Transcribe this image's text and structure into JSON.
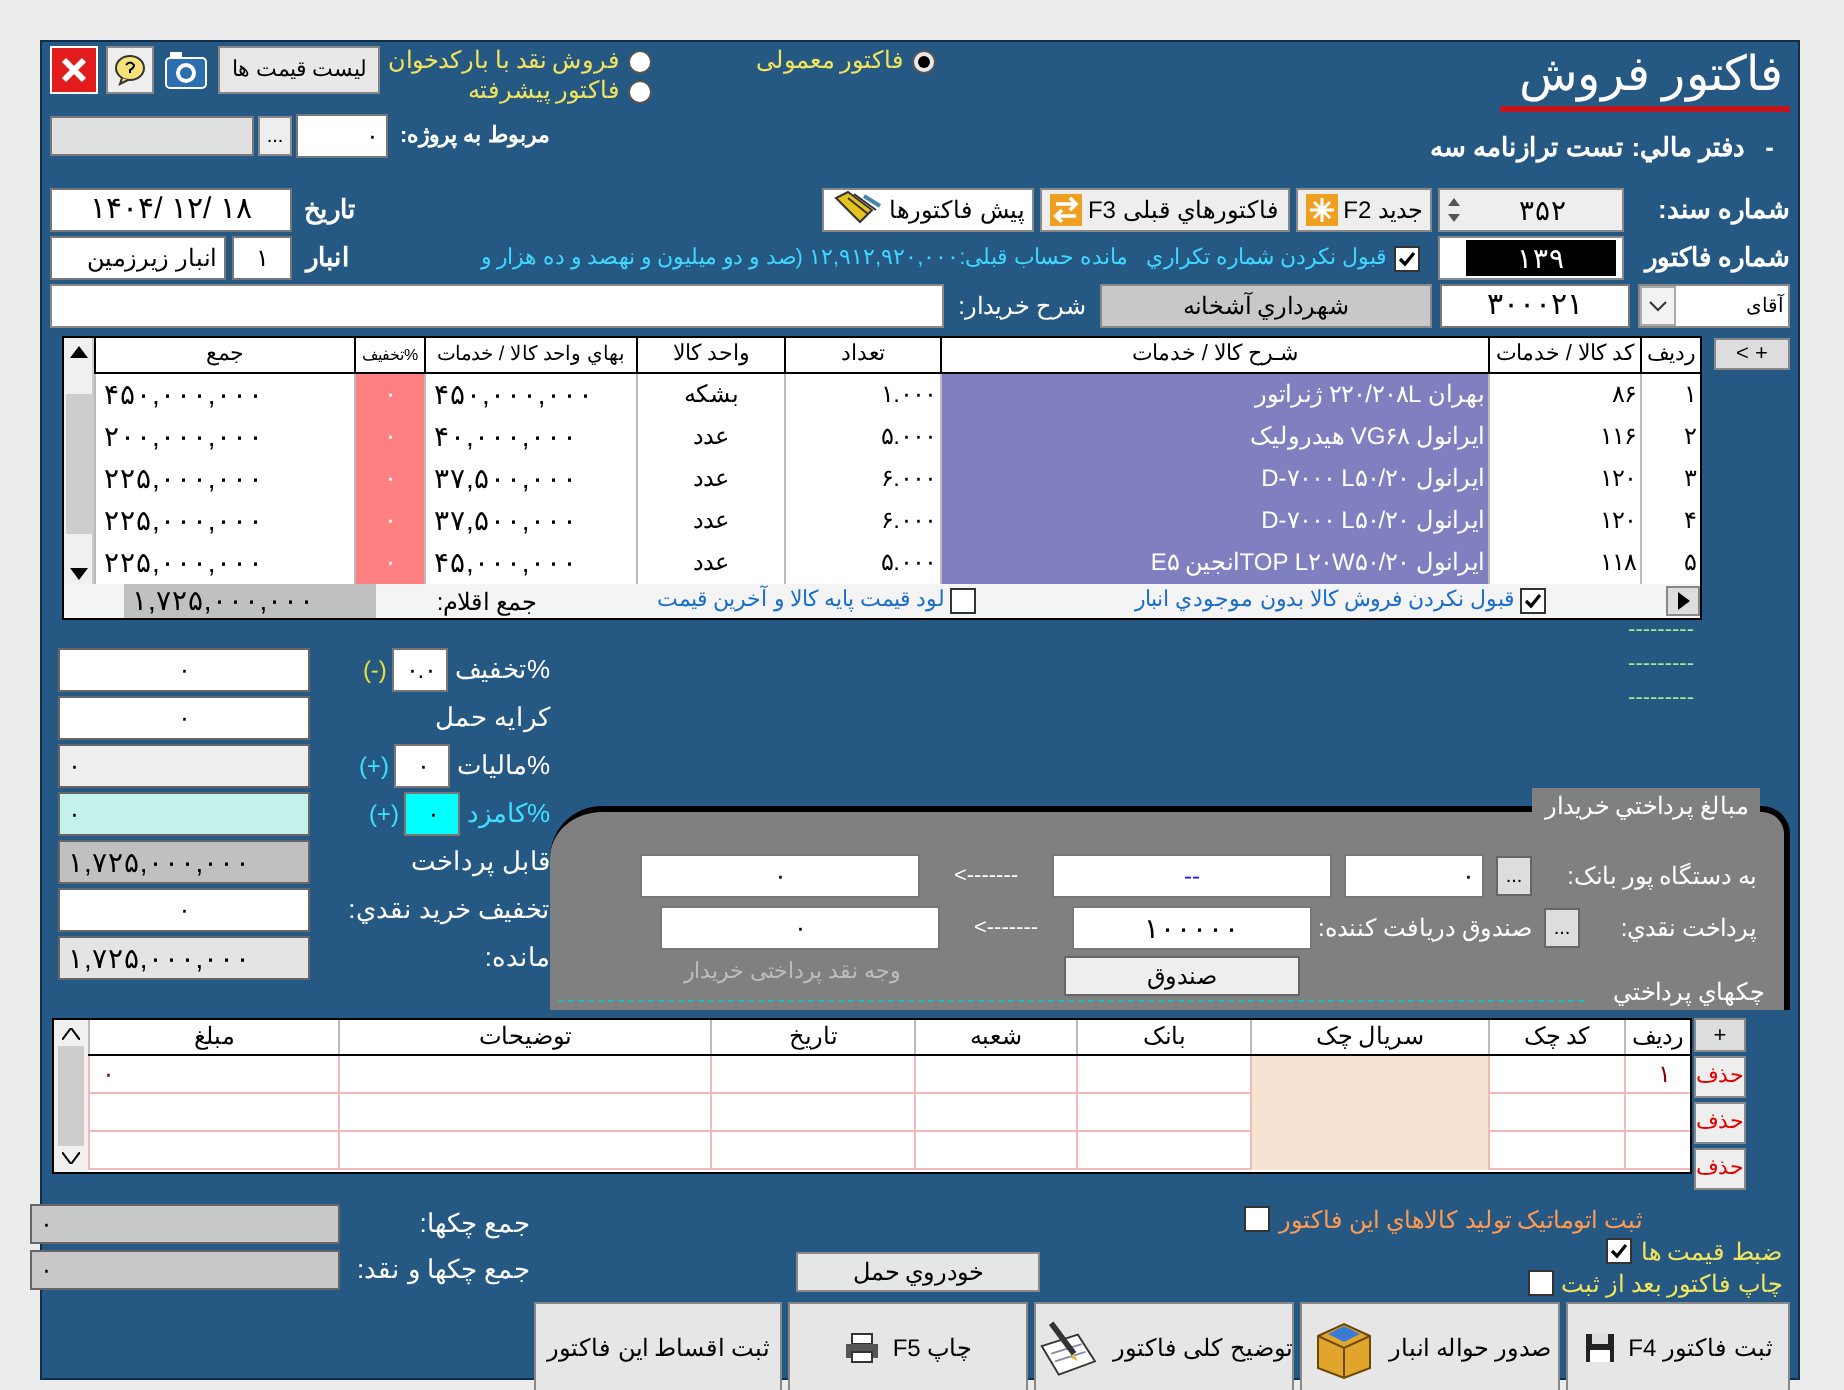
{
  "window": {
    "title": "فاکتور فروش"
  },
  "toolbar": {
    "price_list_button": "لیست قیمت ها"
  },
  "invoice_types": [
    {
      "label": "فاکتور معمولی",
      "selected": true
    },
    {
      "label": "فروش نقد با بارکدخوان",
      "selected": false
    },
    {
      "label": "فاکتور پیشرفته",
      "selected": false
    }
  ],
  "project": {
    "label": "مربوط به پروژه:",
    "code": "۰",
    "browse_button": "..."
  },
  "ledger": {
    "dash": "-",
    "text": "دفتر مالي: تست ترازنامه سه"
  },
  "document": {
    "label": "شماره سند:",
    "number": "۳۵۲",
    "new_button": "جدید F2",
    "previous_button": "فاکتورهاي قبلی F3",
    "proforma_button": "پیش فاکتورها",
    "date_label": "تاریخ",
    "date": "۱۴۰۴/ ۱۲/ ۱۸"
  },
  "invoice": {
    "label": "شماره فاکتور",
    "number": "۱۳۹",
    "reject_duplicate": {
      "label": "قبول نکردن شماره تکراري",
      "checked": true
    },
    "balance": "مانده حساب قبلی:۱۲,۹۱۲,۹۲۰,۰۰۰ (صد و دو میلیون و نهصد و ده هزار و",
    "warehouse_label": "انبار",
    "warehouse_code": "۱",
    "warehouse_name": "انبار زیرزمین"
  },
  "buyer": {
    "title": "آقای",
    "code": "۳۰۰۰۲۱",
    "name_button": "شهرداري آشخانه",
    "description_label": "شرح خریدار:"
  },
  "items": {
    "add_button": "< +",
    "columns": [
      "ردیف",
      "کد کالا / خدمات",
      "شـرح کالا / خدمات",
      "تعداد",
      "واحد کالا",
      "بهاي واحد کالا / خدمات",
      "%تخفیف",
      "جمع"
    ],
    "rows": [
      [
        "۱",
        "۸۶",
        "بهران ۲۲۰/۲۰۸L ژنراتور",
        "۱.۰۰۰",
        "بشکه",
        "۴۵۰,۰۰۰,۰۰۰",
        "۰",
        "۴۵۰,۰۰۰,۰۰۰"
      ],
      [
        "۲",
        "۱۱۶",
        "ایرانول VG۶۸ هیدرولیک",
        "۵.۰۰۰",
        "عدد",
        "۴۰,۰۰۰,۰۰۰",
        "۰",
        "۲۰۰,۰۰۰,۰۰۰"
      ],
      [
        "۳",
        "۱۲۰",
        "ایرانول D-۷۰۰۰ L۵۰/۲۰",
        "۶.۰۰۰",
        "عدد",
        "۳۷,۵۰۰,۰۰۰",
        "۰",
        "۲۲۵,۰۰۰,۰۰۰"
      ],
      [
        "۴",
        "۱۲۰",
        "ایرانول D-۷۰۰۰ L۵۰/۲۰",
        "۶.۰۰۰",
        "عدد",
        "۳۷,۵۰۰,۰۰۰",
        "۰",
        "۲۲۵,۰۰۰,۰۰۰"
      ],
      [
        "۵",
        "۱۱۸",
        "ایرانول TOP L۲۰W۵۰/۲۰انجین E۵",
        "۵.۰۰۰",
        "عدد",
        "۴۵,۰۰۰,۰۰۰",
        "۰",
        "۲۲۵,۰۰۰,۰۰۰"
      ]
    ],
    "reject_no_stock": {
      "label": "قبول نکردن فروش کالا بدون موجودي انبار",
      "checked": true
    },
    "load_base_price": {
      "label": "لود قیمت پایه کالا و آخرین قیمت",
      "checked": false
    },
    "total_label": "جمع اقلام:",
    "total": "۱,۷۲۵,۰۰۰,۰۰۰"
  },
  "dash_notes": [
    "---------",
    "---------",
    "---------"
  ],
  "totals": [
    {
      "kind": "percent",
      "label": "%تخفیف",
      "percent": "۰.۰",
      "sign": "(-)",
      "value": "۰"
    },
    {
      "kind": "plain",
      "label": "کرایه حمل",
      "value": "۰"
    },
    {
      "kind": "percent",
      "label": "%مالیات",
      "percent": "۰",
      "sign": "(+)",
      "value": "۰"
    },
    {
      "kind": "commission",
      "label": "%کامزد",
      "percent": "۰",
      "sign": "(+)",
      "value": "۰"
    },
    {
      "kind": "sum",
      "label": "قابل پرداخت",
      "value": "۱,۷۲۵,۰۰۰,۰۰۰"
    },
    {
      "kind": "plain",
      "label": "تخفیف خرید نقدي:",
      "value": "۰"
    },
    {
      "kind": "sum",
      "label": "مانده:",
      "value": "۱,۷۲۵,۰۰۰,۰۰۰"
    }
  ],
  "payment": {
    "title": "مبالغ پرداختي خریدار",
    "pos_label": "به دستگاه پور بانک:",
    "pos_browse": "...",
    "pos_code": "۰",
    "pos_name": "--",
    "pos_arrow": "<-------",
    "pos_amount": "۰",
    "cash_label": "پرداخت نقدي:",
    "cashbox_browse": "...",
    "cashbox_label": "صندوق دریافت کننده:",
    "cashbox_code": "۱۰۰۰۰۰",
    "cash_arrow": "<-------",
    "cash_amount": "۰",
    "cash_hint": "وجه نقد پرداختی خریدار",
    "cashbox_button": "صندوق"
  },
  "cheques": {
    "title": "چکهاي پرداختي",
    "add_button": "+",
    "columns": [
      "ردیف",
      "کد چک",
      "سریال چک",
      "بانک",
      "شعبه",
      "تاریخ",
      "توضیحات",
      "مبلغ"
    ],
    "rows": [
      [
        "۱",
        "",
        "",
        "",
        "",
        "",
        "",
        "۰"
      ],
      [
        "",
        "",
        "",
        "",
        "",
        "",
        "",
        ""
      ],
      [
        "",
        "",
        "",
        "",
        "",
        "",
        "",
        ""
      ]
    ],
    "delete_buttons": [
      "حذف",
      "حذف",
      "حذف"
    ]
  },
  "cheque_totals": [
    {
      "label": "جمع چکها:",
      "value": "۰"
    },
    {
      "label": "جمع چکها و نقد:",
      "value": "۰"
    }
  ],
  "options": [
    {
      "label": "ثبت اتوماتیک تولید کالاهاي این فاکتور",
      "checked": false
    },
    {
      "label": "ضبط قیمت ها",
      "checked": true
    },
    {
      "label": "چاپ فاکتور بعد از ثبت",
      "checked": false
    }
  ],
  "vehicle_button": "خودروي حمل",
  "actions": [
    {
      "kind": "save",
      "label": "ثبت فاکتور F4"
    },
    {
      "kind": "warehouse",
      "label": "صدور حواله انبار"
    },
    {
      "kind": "note",
      "label": "توضیح کلی فاکتور"
    },
    {
      "kind": "print",
      "label": "چاپ F5"
    },
    {
      "kind": "plain",
      "label": "ثبت اقساط این فاکتور"
    }
  ]
}
